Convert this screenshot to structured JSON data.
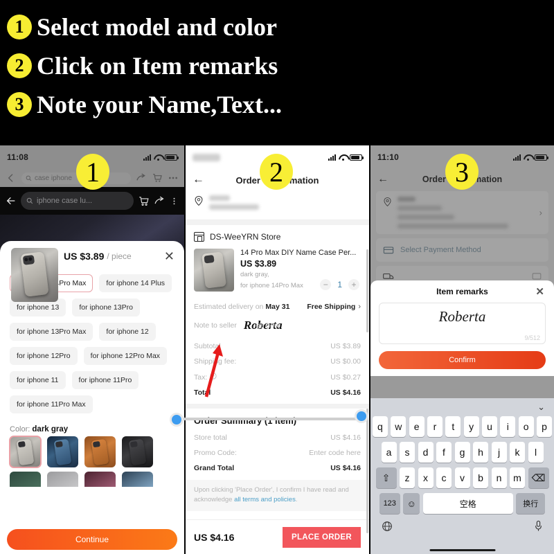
{
  "banner": {
    "steps": [
      {
        "num": "1",
        "text": "Select model and color"
      },
      {
        "num": "2",
        "text": "Click on Item remarks"
      },
      {
        "num": "3",
        "text": "Note your Name,Text..."
      }
    ],
    "colon": ":"
  },
  "panel1": {
    "badge": "1",
    "status": {
      "time": "11:08"
    },
    "ghost_search_text": "case iphone",
    "search_placeholder": "iphone case lu...",
    "price": "US $3.89",
    "price_unit": "/ piece",
    "close": "✕",
    "options": [
      [
        "for iphone 14Pro Max",
        "for iphone 14 Plus"
      ],
      [
        "for iphone 13",
        "for iphone 13Pro"
      ],
      [
        "for iphone 13Pro Max",
        "for iphone 12"
      ],
      [
        "for iphone 12Pro",
        "for iphone 12Pro Max"
      ],
      [
        "for iphone 11",
        "for iphone 11Pro"
      ],
      [
        "for iphone 11Pro Max"
      ]
    ],
    "selected_option": "for iphone 14Pro Max",
    "color_label": "Color:",
    "color_value": "dark gray",
    "swatch_colors": [
      "#8f8d88",
      "#3a5b7d",
      "#c07133",
      "#2f3134"
    ],
    "swatch_colors_row2": [
      "#3e5a4f",
      "#b9b9ba",
      "#9e5a72",
      "#6b8fab"
    ],
    "cta": "Continue"
  },
  "panel2": {
    "badge": "2",
    "title": "Order Confirmation",
    "back": "←",
    "store": "DS-WeeYRN Store",
    "item_name": "14 Pro Max DIY Name Case Per...",
    "item_price": "US $3.89",
    "item_color": "dark gray,",
    "item_model": "for iphone 14Pro Max",
    "qty_minus": "−",
    "qty_value": "1",
    "qty_plus": "+",
    "delivery_prefix": "Estimated delivery on",
    "delivery_date": "May 31",
    "shipping": "Free Shipping",
    "shipping_chevron": "›",
    "note_label": "Note to seller",
    "note_value": "Roberta",
    "note_placeholder": "ge here",
    "totals": [
      {
        "label": "Subtotal",
        "value": "US $3.89",
        "bold": false
      },
      {
        "label": "Shipping fee:",
        "value": "US $0.00",
        "bold": false
      },
      {
        "label": "Tax:",
        "value": "US $0.27",
        "bold": false
      },
      {
        "label": "Total",
        "value": "US $4.16",
        "bold": true
      }
    ],
    "summary_title": "Order Summary (1 item)",
    "summary_rows": [
      {
        "label": "Store total",
        "value": "US $4.16",
        "bold": false,
        "link": false
      },
      {
        "label": "Promo Code:",
        "value": "Enter code here",
        "bold": false,
        "link": true
      },
      {
        "label": "Grand Total",
        "value": "US $4.16",
        "bold": true,
        "link": false
      }
    ],
    "terms_prefix": "Upon clicking 'Place Order', I confirm I have read and acknowledge ",
    "terms_link": "all terms and policies",
    "terms_suffix": ".",
    "bottom_total": "US $4.16",
    "place_order": "PLACE ORDER"
  },
  "panel3": {
    "badge": "3",
    "status": {
      "time": "11:10"
    },
    "title": "Order Confirmation",
    "back": "←",
    "chevron": "›",
    "payment_label": "Select Payment Method",
    "modal_title": "Item remarks",
    "modal_close": "✕",
    "remark_value": "Roberta",
    "char_count": "9/512",
    "confirm": "Confirm",
    "kb_collapse": "⌄",
    "kb_row1": [
      "q",
      "w",
      "e",
      "r",
      "t",
      "y",
      "u",
      "i",
      "o",
      "p"
    ],
    "kb_row2": [
      "a",
      "s",
      "d",
      "f",
      "g",
      "h",
      "j",
      "k",
      "l"
    ],
    "kb_row3_shift": "⇧",
    "kb_row3": [
      "z",
      "x",
      "c",
      "v",
      "b",
      "n",
      "m"
    ],
    "kb_row3_back": "⌫",
    "kb_num": "123",
    "kb_emoji": "☺",
    "kb_space": "空格",
    "kb_return": "换行",
    "kb_globe": "⊕",
    "kb_mic": "Ἲ4"
  },
  "colors": {
    "accent_yellow": "#f8ee35",
    "orange": "#f6501e",
    "red": "#f2565c",
    "blue_dot": "#3d9cf0",
    "arrow_red": "#e61c1c"
  }
}
